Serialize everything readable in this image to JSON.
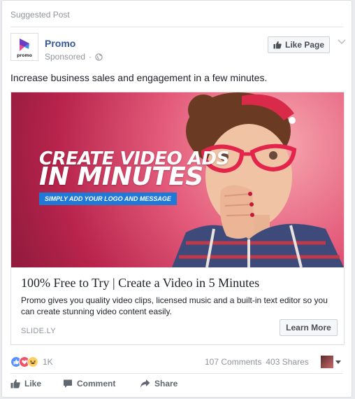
{
  "header": {
    "suggested_label": "Suggested Post"
  },
  "post": {
    "page_name": "Promo",
    "sponsored_label": "Sponsored",
    "like_page_label": "Like Page",
    "text": "Increase business sales and engagement in a few minutes."
  },
  "ad": {
    "image_headline_line1": "CREATE VIDEO ADS",
    "image_headline_line2": "IN MINUTES",
    "image_subline": "SIMPLY ADD YOUR LOGO AND MESSAGE",
    "title": "100% Free to Try | Create a Video in 5 Minutes",
    "description": "Promo gives you quality video clips, licensed music and a built-in text editor so you can create stunning video content easily.",
    "domain": "SLIDE.LY",
    "cta_label": "Learn More"
  },
  "stats": {
    "reactions_count": "1K",
    "comments": "107 Comments",
    "shares": "403 Shares"
  },
  "actions": {
    "like": "Like",
    "comment": "Comment",
    "share": "Share"
  },
  "colors": {
    "link_blue": "#365899",
    "meta_gray": "#90949c",
    "like_blue": "#5890ff",
    "love_red": "#f25268",
    "haha_yellow": "#fcd062",
    "ad_blue_bar": "#1e7ad6"
  },
  "icons": {
    "logo": "promo-logo-icon",
    "globe": "globe-icon",
    "like_page": "thumbs-up-icon",
    "menu": "chevron-down-icon",
    "reactions": [
      "like-reaction-icon",
      "love-reaction-icon",
      "haha-reaction-icon"
    ]
  }
}
